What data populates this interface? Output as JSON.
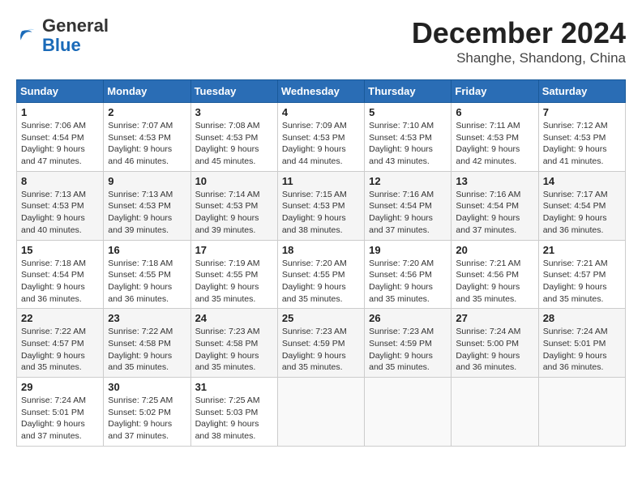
{
  "logo": {
    "general": "General",
    "blue": "Blue"
  },
  "header": {
    "month": "December 2024",
    "location": "Shanghe, Shandong, China"
  },
  "weekdays": [
    "Sunday",
    "Monday",
    "Tuesday",
    "Wednesday",
    "Thursday",
    "Friday",
    "Saturday"
  ],
  "weeks": [
    [
      {
        "day": 1,
        "sunrise": "7:06 AM",
        "sunset": "4:54 PM",
        "daylight": "9 hours and 47 minutes."
      },
      {
        "day": 2,
        "sunrise": "7:07 AM",
        "sunset": "4:53 PM",
        "daylight": "9 hours and 46 minutes."
      },
      {
        "day": 3,
        "sunrise": "7:08 AM",
        "sunset": "4:53 PM",
        "daylight": "9 hours and 45 minutes."
      },
      {
        "day": 4,
        "sunrise": "7:09 AM",
        "sunset": "4:53 PM",
        "daylight": "9 hours and 44 minutes."
      },
      {
        "day": 5,
        "sunrise": "7:10 AM",
        "sunset": "4:53 PM",
        "daylight": "9 hours and 43 minutes."
      },
      {
        "day": 6,
        "sunrise": "7:11 AM",
        "sunset": "4:53 PM",
        "daylight": "9 hours and 42 minutes."
      },
      {
        "day": 7,
        "sunrise": "7:12 AM",
        "sunset": "4:53 PM",
        "daylight": "9 hours and 41 minutes."
      }
    ],
    [
      {
        "day": 8,
        "sunrise": "7:13 AM",
        "sunset": "4:53 PM",
        "daylight": "9 hours and 40 minutes."
      },
      {
        "day": 9,
        "sunrise": "7:13 AM",
        "sunset": "4:53 PM",
        "daylight": "9 hours and 39 minutes."
      },
      {
        "day": 10,
        "sunrise": "7:14 AM",
        "sunset": "4:53 PM",
        "daylight": "9 hours and 39 minutes."
      },
      {
        "day": 11,
        "sunrise": "7:15 AM",
        "sunset": "4:53 PM",
        "daylight": "9 hours and 38 minutes."
      },
      {
        "day": 12,
        "sunrise": "7:16 AM",
        "sunset": "4:54 PM",
        "daylight": "9 hours and 37 minutes."
      },
      {
        "day": 13,
        "sunrise": "7:16 AM",
        "sunset": "4:54 PM",
        "daylight": "9 hours and 37 minutes."
      },
      {
        "day": 14,
        "sunrise": "7:17 AM",
        "sunset": "4:54 PM",
        "daylight": "9 hours and 36 minutes."
      }
    ],
    [
      {
        "day": 15,
        "sunrise": "7:18 AM",
        "sunset": "4:54 PM",
        "daylight": "9 hours and 36 minutes."
      },
      {
        "day": 16,
        "sunrise": "7:18 AM",
        "sunset": "4:55 PM",
        "daylight": "9 hours and 36 minutes."
      },
      {
        "day": 17,
        "sunrise": "7:19 AM",
        "sunset": "4:55 PM",
        "daylight": "9 hours and 35 minutes."
      },
      {
        "day": 18,
        "sunrise": "7:20 AM",
        "sunset": "4:55 PM",
        "daylight": "9 hours and 35 minutes."
      },
      {
        "day": 19,
        "sunrise": "7:20 AM",
        "sunset": "4:56 PM",
        "daylight": "9 hours and 35 minutes."
      },
      {
        "day": 20,
        "sunrise": "7:21 AM",
        "sunset": "4:56 PM",
        "daylight": "9 hours and 35 minutes."
      },
      {
        "day": 21,
        "sunrise": "7:21 AM",
        "sunset": "4:57 PM",
        "daylight": "9 hours and 35 minutes."
      }
    ],
    [
      {
        "day": 22,
        "sunrise": "7:22 AM",
        "sunset": "4:57 PM",
        "daylight": "9 hours and 35 minutes."
      },
      {
        "day": 23,
        "sunrise": "7:22 AM",
        "sunset": "4:58 PM",
        "daylight": "9 hours and 35 minutes."
      },
      {
        "day": 24,
        "sunrise": "7:23 AM",
        "sunset": "4:58 PM",
        "daylight": "9 hours and 35 minutes."
      },
      {
        "day": 25,
        "sunrise": "7:23 AM",
        "sunset": "4:59 PM",
        "daylight": "9 hours and 35 minutes."
      },
      {
        "day": 26,
        "sunrise": "7:23 AM",
        "sunset": "4:59 PM",
        "daylight": "9 hours and 35 minutes."
      },
      {
        "day": 27,
        "sunrise": "7:24 AM",
        "sunset": "5:00 PM",
        "daylight": "9 hours and 36 minutes."
      },
      {
        "day": 28,
        "sunrise": "7:24 AM",
        "sunset": "5:01 PM",
        "daylight": "9 hours and 36 minutes."
      }
    ],
    [
      {
        "day": 29,
        "sunrise": "7:24 AM",
        "sunset": "5:01 PM",
        "daylight": "9 hours and 37 minutes."
      },
      {
        "day": 30,
        "sunrise": "7:25 AM",
        "sunset": "5:02 PM",
        "daylight": "9 hours and 37 minutes."
      },
      {
        "day": 31,
        "sunrise": "7:25 AM",
        "sunset": "5:03 PM",
        "daylight": "9 hours and 38 minutes."
      },
      null,
      null,
      null,
      null
    ]
  ]
}
